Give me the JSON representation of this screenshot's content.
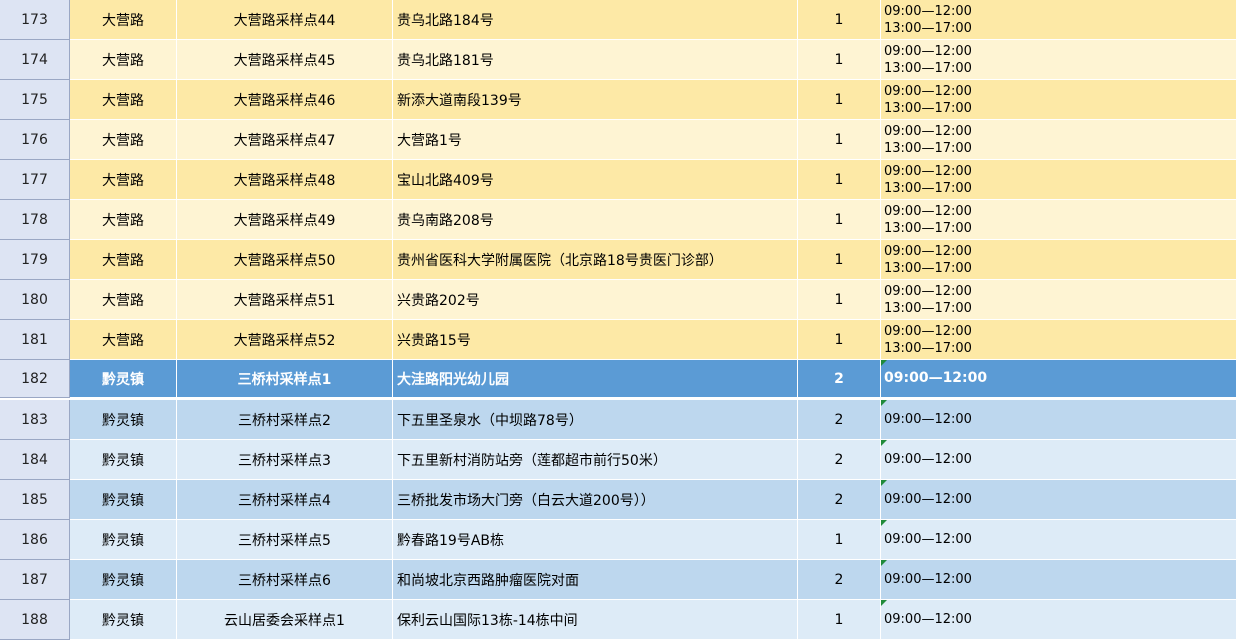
{
  "rows": [
    {
      "num": "173",
      "town": "大营路",
      "point": "大营路采样点44",
      "address": "贵乌北路184号",
      "count": "1",
      "time1": "09:00—12:00",
      "time2": "13:00—17:00",
      "style": "yellow-a"
    },
    {
      "num": "174",
      "town": "大营路",
      "point": "大营路采样点45",
      "address": "贵乌北路181号",
      "count": "1",
      "time1": "09:00—12:00",
      "time2": "13:00—17:00",
      "style": "yellow-b"
    },
    {
      "num": "175",
      "town": "大营路",
      "point": "大营路采样点46",
      "address": "新添大道南段139号",
      "count": "1",
      "time1": "09:00—12:00",
      "time2": "13:00—17:00",
      "style": "yellow-a"
    },
    {
      "num": "176",
      "town": "大营路",
      "point": "大营路采样点47",
      "address": "大营路1号",
      "count": "1",
      "time1": "09:00—12:00",
      "time2": "13:00—17:00",
      "style": "yellow-b"
    },
    {
      "num": "177",
      "town": "大营路",
      "point": "大营路采样点48",
      "address": "宝山北路409号",
      "count": "1",
      "time1": "09:00—12:00",
      "time2": "13:00—17:00",
      "style": "yellow-a"
    },
    {
      "num": "178",
      "town": "大营路",
      "point": "大营路采样点49",
      "address": "贵乌南路208号",
      "count": "1",
      "time1": "09:00—12:00",
      "time2": "13:00—17:00",
      "style": "yellow-b"
    },
    {
      "num": "179",
      "town": "大营路",
      "point": "大营路采样点50",
      "address": "贵州省医科大学附属医院（北京路18号贵医门诊部）",
      "count": "1",
      "time1": "09:00—12:00",
      "time2": "13:00—17:00",
      "style": "yellow-a"
    },
    {
      "num": "180",
      "town": "大营路",
      "point": "大营路采样点51",
      "address": "兴贵路202号",
      "count": "1",
      "time1": "09:00—12:00",
      "time2": "13:00—17:00",
      "style": "yellow-b"
    },
    {
      "num": "181",
      "town": "大营路",
      "point": "大营路采样点52",
      "address": "兴贵路15号",
      "count": "1",
      "time1": "09:00—12:00",
      "time2": "13:00—17:00",
      "style": "yellow-a"
    },
    {
      "num": "182",
      "town": "黔灵镇",
      "point": "三桥村采样点1",
      "address": "大洼路阳光幼儿园",
      "count": "2",
      "time1": "09:00—12:00",
      "time2": "",
      "style": "blue-h"
    },
    {
      "num": "183",
      "town": "黔灵镇",
      "point": "三桥村采样点2",
      "address": "下五里圣泉水（中坝路78号）",
      "count": "2",
      "time1": "09:00—12:00",
      "time2": "",
      "style": "blue-a"
    },
    {
      "num": "184",
      "town": "黔灵镇",
      "point": "三桥村采样点3",
      "address": "下五里新村消防站旁（莲都超市前行50米）",
      "count": "2",
      "time1": "09:00—12:00",
      "time2": "",
      "style": "blue-b"
    },
    {
      "num": "185",
      "town": "黔灵镇",
      "point": "三桥村采样点4",
      "address": "三桥批发市场大门旁（白云大道200号））",
      "count": "2",
      "time1": "09:00—12:00",
      "time2": "",
      "style": "blue-a"
    },
    {
      "num": "186",
      "town": "黔灵镇",
      "point": "三桥村采样点5",
      "address": "黔春路19号AB栋",
      "count": "1",
      "time1": "09:00—12:00",
      "time2": "",
      "style": "blue-b"
    },
    {
      "num": "187",
      "town": "黔灵镇",
      "point": "三桥村采样点6",
      "address": "和尚坡北京西路肿瘤医院对面",
      "count": "2",
      "time1": "09:00—12:00",
      "time2": "",
      "style": "blue-a"
    },
    {
      "num": "188",
      "town": "黔灵镇",
      "point": "云山居委会采样点1",
      "address": "保利云山国际13栋-14栋中间",
      "count": "1",
      "time1": "09:00—12:00",
      "time2": "",
      "style": "blue-b"
    }
  ]
}
